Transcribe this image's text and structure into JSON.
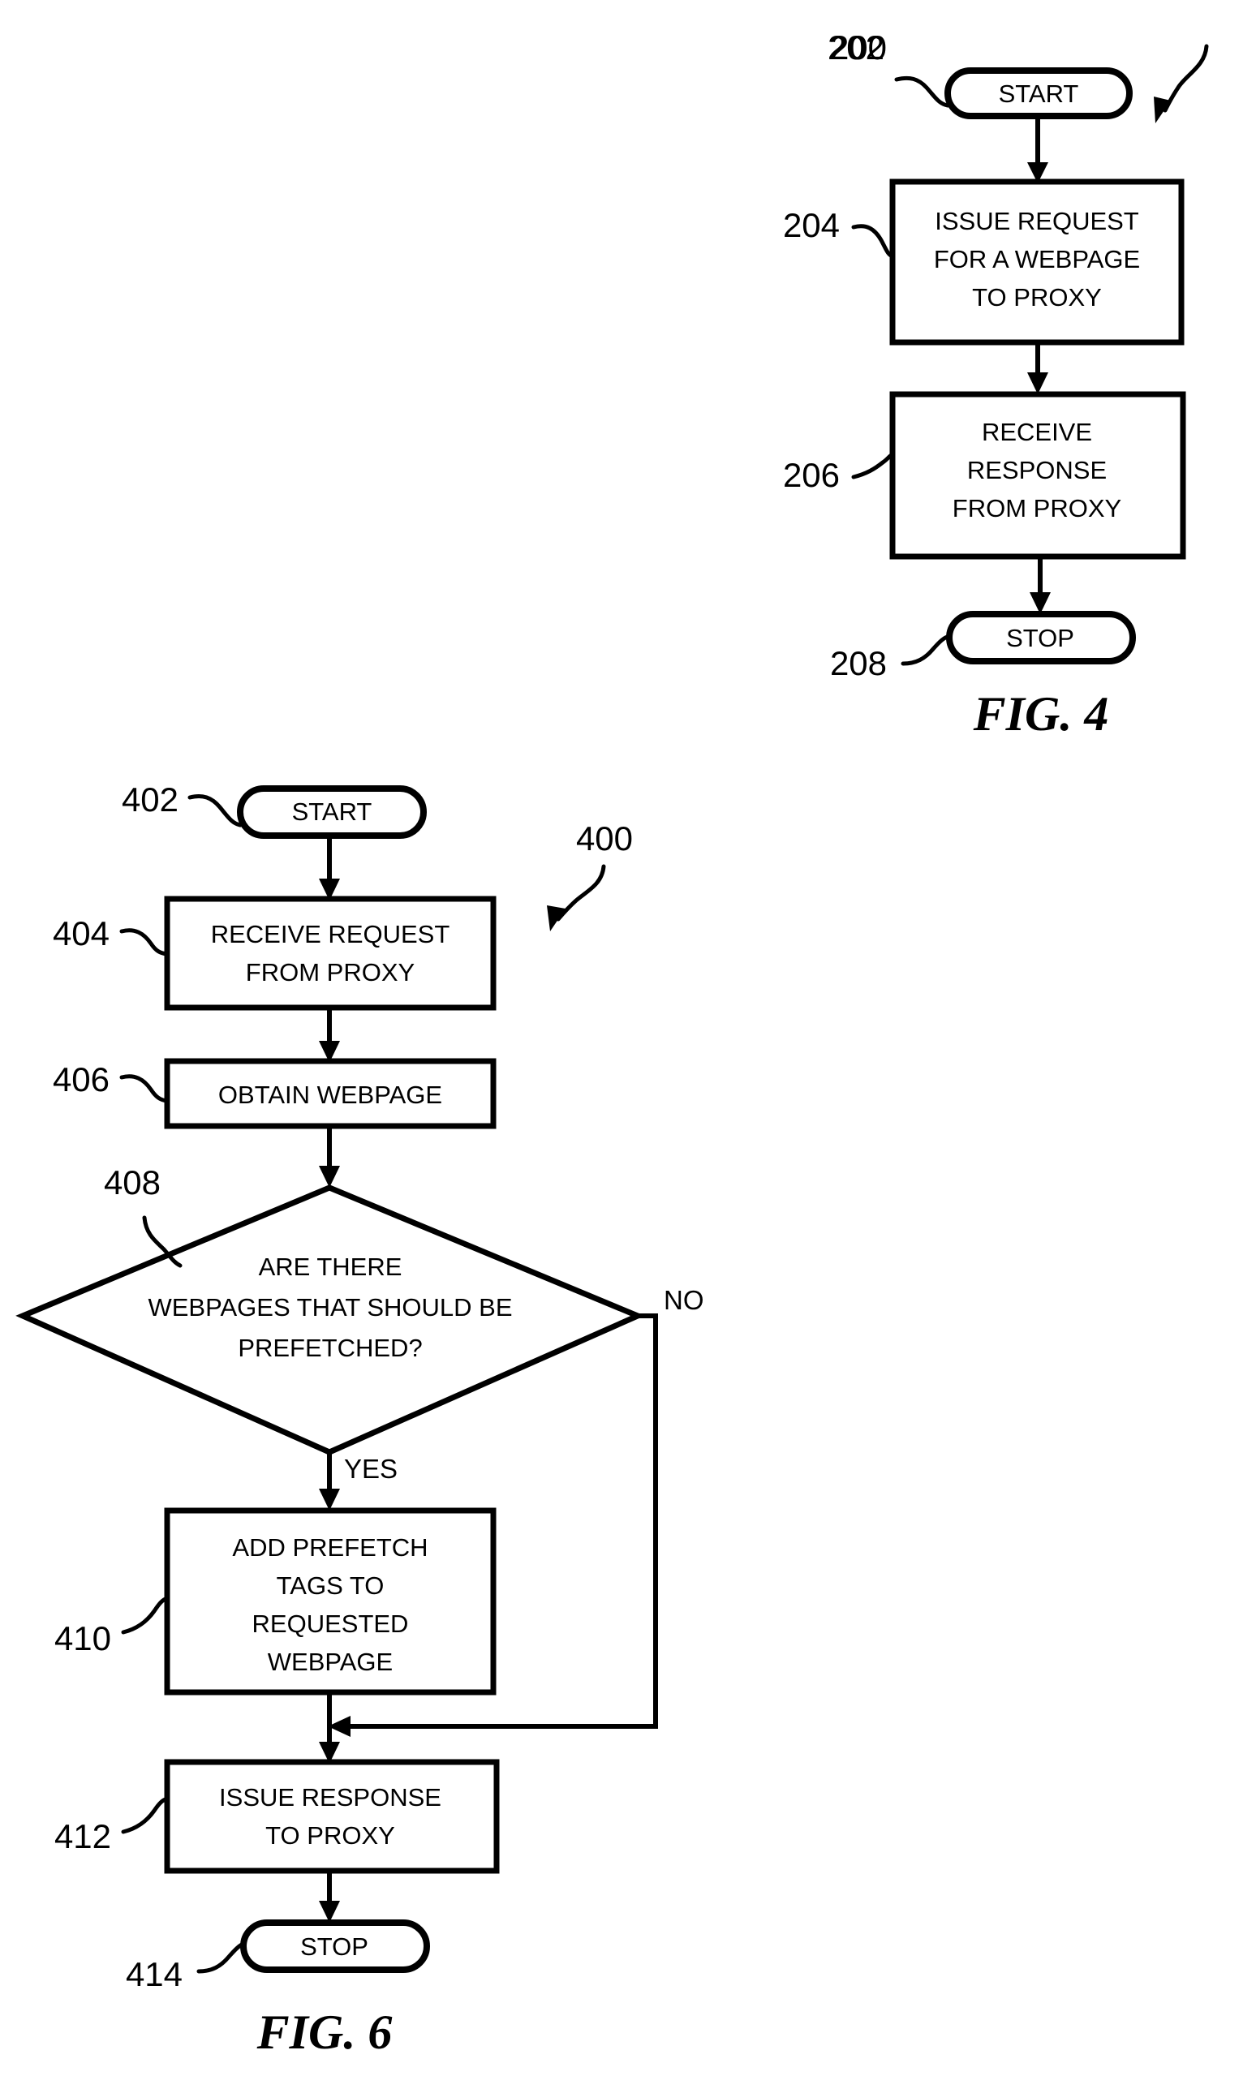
{
  "document": {
    "kind": "patent-drawing-sheet",
    "background_color": "#ffffff",
    "ink_color": "#000000"
  },
  "figures": [
    {
      "id": "fig4",
      "caption": "FIG. 4",
      "flow_ref": "200",
      "nodes": [
        {
          "ref": "202",
          "type": "terminator",
          "label": "START"
        },
        {
          "ref": "204",
          "type": "process",
          "lines": [
            "ISSUE REQUEST",
            "FOR A WEBPAGE",
            "TO PROXY"
          ]
        },
        {
          "ref": "206",
          "type": "process",
          "lines": [
            "RECEIVE",
            "RESPONSE",
            "FROM PROXY"
          ]
        },
        {
          "ref": "208",
          "type": "terminator",
          "label": "STOP"
        }
      ]
    },
    {
      "id": "fig6",
      "caption": "FIG. 6",
      "flow_ref": "400",
      "nodes": [
        {
          "ref": "402",
          "type": "terminator",
          "label": "START"
        },
        {
          "ref": "404",
          "type": "process",
          "lines": [
            "RECEIVE REQUEST",
            "FROM PROXY"
          ]
        },
        {
          "ref": "406",
          "type": "process",
          "lines": [
            "OBTAIN WEBPAGE"
          ]
        },
        {
          "ref": "408",
          "type": "decision",
          "lines": [
            "ARE THERE",
            "WEBPAGES THAT SHOULD BE",
            "PREFETCHED?"
          ]
        },
        {
          "ref": "410",
          "type": "process",
          "lines": [
            "ADD PREFETCH",
            "TAGS TO",
            "REQUESTED",
            "WEBPAGE"
          ]
        },
        {
          "ref": "412",
          "type": "process",
          "lines": [
            "ISSUE RESPONSE",
            "TO PROXY"
          ]
        },
        {
          "ref": "414",
          "type": "terminator",
          "label": "STOP"
        }
      ],
      "branch_labels": {
        "yes": "YES",
        "no": "NO"
      }
    }
  ],
  "fig4": {
    "caption": "FIG. 4",
    "flow_ref": "200",
    "n202": {
      "ref": "202",
      "label": "START"
    },
    "n204": {
      "ref": "204",
      "l1": "ISSUE REQUEST",
      "l2": "FOR A WEBPAGE",
      "l3": "TO PROXY"
    },
    "n206": {
      "ref": "206",
      "l1": "RECEIVE",
      "l2": "RESPONSE",
      "l3": "FROM PROXY"
    },
    "n208": {
      "ref": "208",
      "label": "STOP"
    }
  },
  "fig6": {
    "caption": "FIG. 6",
    "flow_ref": "400",
    "n402": {
      "ref": "402",
      "label": "START"
    },
    "n404": {
      "ref": "404",
      "l1": "RECEIVE REQUEST",
      "l2": "FROM PROXY"
    },
    "n406": {
      "ref": "406",
      "l1": "OBTAIN WEBPAGE"
    },
    "n408": {
      "ref": "408",
      "l1": "ARE THERE",
      "l2": "WEBPAGES THAT SHOULD BE",
      "l3": "PREFETCHED?"
    },
    "n410": {
      "ref": "410",
      "l1": "ADD PREFETCH",
      "l2": "TAGS TO",
      "l3": "REQUESTED",
      "l4": "WEBPAGE"
    },
    "n412": {
      "ref": "412",
      "l1": "ISSUE RESPONSE",
      "l2": "TO PROXY"
    },
    "n414": {
      "ref": "414",
      "label": "STOP"
    },
    "yes_label": "YES",
    "no_label": "NO"
  }
}
